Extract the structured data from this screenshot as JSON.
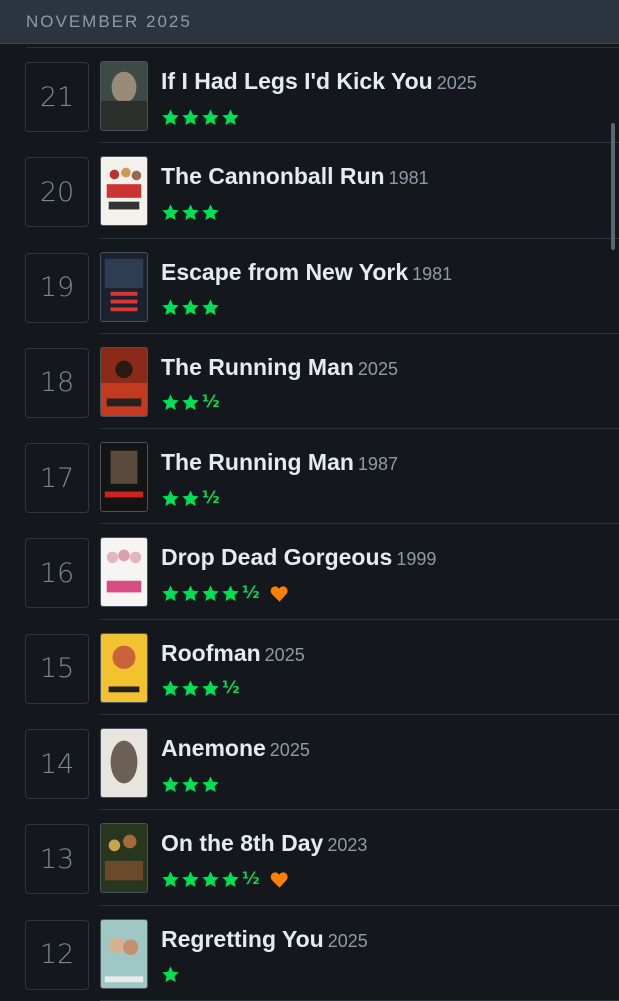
{
  "header": {
    "month": "NOVEMBER 2025"
  },
  "colors": {
    "star": "#00e054",
    "heart": "#ff8000",
    "background": "#14181c"
  },
  "entries": [
    {
      "day": "21",
      "title": "If I Had Legs I'd Kick You",
      "year": "2025",
      "stars": 4,
      "half": false,
      "liked": false,
      "poster_icon": "poster-if-i-had-legs",
      "poster_text": "IF I HAD LEGS I'D KICK YOU"
    },
    {
      "day": "20",
      "title": "The Cannonball Run",
      "year": "1981",
      "stars": 3,
      "half": false,
      "liked": false,
      "poster_icon": "poster-cannonball-run",
      "poster_text": ""
    },
    {
      "day": "19",
      "title": "Escape from New York",
      "year": "1981",
      "stars": 3,
      "half": false,
      "liked": false,
      "poster_icon": "poster-escape-from-new-york",
      "poster_text": "ESCAPE FROM NEW YORK"
    },
    {
      "day": "18",
      "title": "The Running Man",
      "year": "2025",
      "stars": 2,
      "half": true,
      "liked": false,
      "poster_icon": "poster-running-man-2025",
      "poster_text": ""
    },
    {
      "day": "17",
      "title": "The Running Man",
      "year": "1987",
      "stars": 2,
      "half": true,
      "liked": false,
      "poster_icon": "poster-running-man-1987",
      "poster_text": ""
    },
    {
      "day": "16",
      "title": "Drop Dead Gorgeous",
      "year": "1999",
      "stars": 4,
      "half": true,
      "liked": true,
      "poster_icon": "poster-drop-dead-gorgeous",
      "poster_text": ""
    },
    {
      "day": "15",
      "title": "Roofman",
      "year": "2025",
      "stars": 3,
      "half": true,
      "liked": false,
      "poster_icon": "poster-roofman",
      "poster_text": "ROOFMAN"
    },
    {
      "day": "14",
      "title": "Anemone",
      "year": "2025",
      "stars": 3,
      "half": false,
      "liked": false,
      "poster_icon": "poster-anemone",
      "poster_text": ""
    },
    {
      "day": "13",
      "title": "On the 8th Day",
      "year": "2023",
      "stars": 4,
      "half": true,
      "liked": true,
      "poster_icon": "poster-on-the-8th-day",
      "poster_text": ""
    },
    {
      "day": "12",
      "title": "Regretting You",
      "year": "2025",
      "stars": 1,
      "half": false,
      "liked": false,
      "poster_icon": "poster-regretting-you",
      "poster_text": "REGRETTING YOU"
    }
  ]
}
